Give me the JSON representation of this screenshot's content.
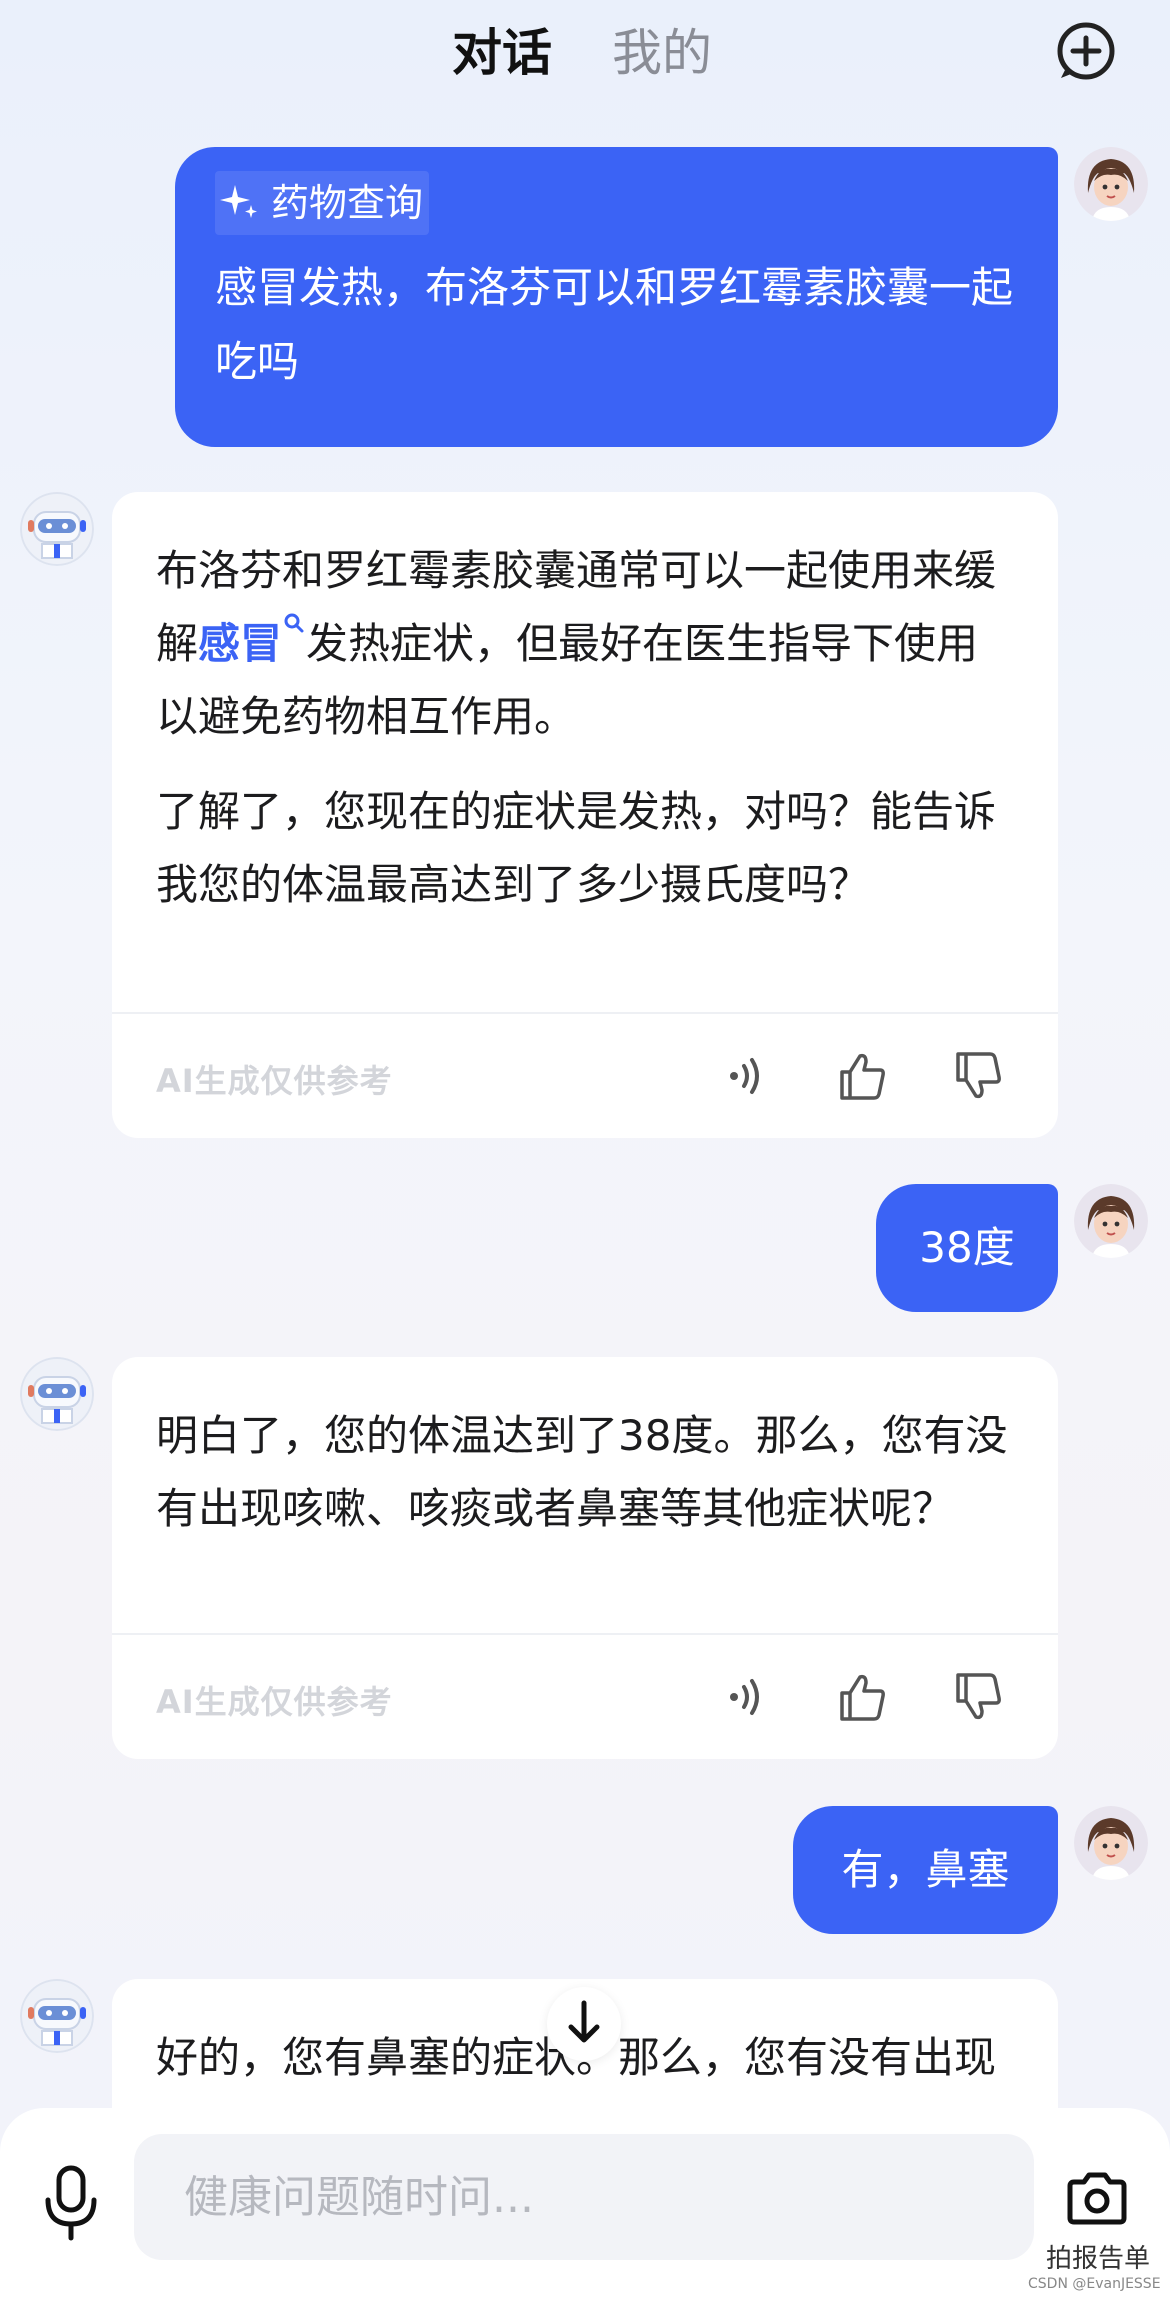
{
  "header": {
    "tabs": [
      {
        "label": "对话",
        "active": true
      },
      {
        "label": "我的",
        "active": false
      }
    ],
    "new_chat_icon": "plus-circle-icon"
  },
  "messages": [
    {
      "role": "user",
      "chip": "药物查询",
      "text": "感冒发热，布洛芬可以和罗红霉素胶囊一起吃吗"
    },
    {
      "role": "bot",
      "p1_before": "布洛芬和罗红霉素胶囊通常可以一起使用来缓解",
      "p1_link": "感冒",
      "p1_after": "发热症状，但最好在医生指导下使用以避免药物相互作用。",
      "p2": "了解了，您现在的症状是发热，对吗？能告诉我您的体温最高达到了多少摄氏度吗？",
      "disclaimer": "AI生成仅供参考"
    },
    {
      "role": "user",
      "text": "38度"
    },
    {
      "role": "bot",
      "p1": "明白了，您的体温达到了38度。那么，您有没有出现咳嗽、咳痰或者鼻塞等其他症状呢？",
      "disclaimer": "AI生成仅供参考"
    },
    {
      "role": "user",
      "text": "有，鼻塞"
    },
    {
      "role": "bot",
      "p1": "好的，您有鼻塞的症状。那么，您有没有出现恶心、呕吐、腹痛等其他症状呢？"
    }
  ],
  "composer": {
    "placeholder": "健康问题随时问...",
    "camera_label": "拍报告单"
  },
  "watermark": "CSDN @EvanJESSE",
  "colors": {
    "accent": "#3b63f5",
    "card": "#ffffff"
  }
}
